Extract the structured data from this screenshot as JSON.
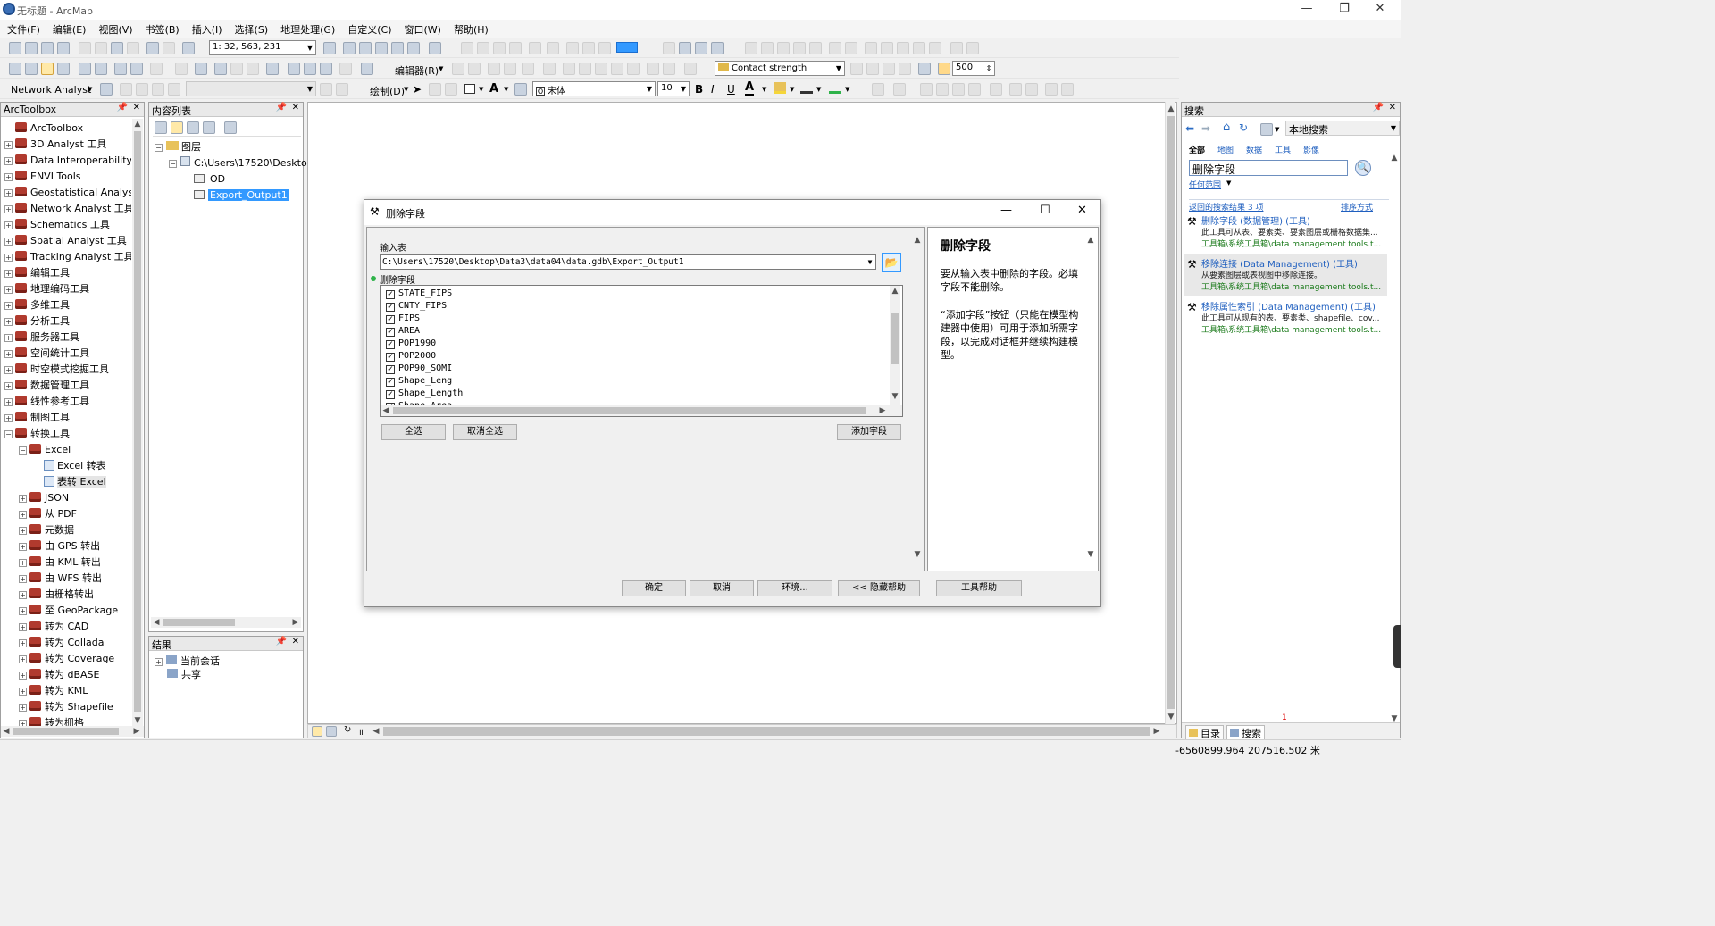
{
  "window": {
    "title": "无标题 - ArcMap"
  },
  "menu": [
    "文件(F)",
    "编辑(E)",
    "视图(V)",
    "书签(B)",
    "插入(I)",
    "选择(S)",
    "地理处理(G)",
    "自定义(C)",
    "窗口(W)",
    "帮助(H)"
  ],
  "toolbar": {
    "scale": "1: 32, 563, 231",
    "editor_label": "编辑器(R)",
    "geocode_combo": "Contact strength",
    "network_analyst": "Network Analyst",
    "draw_label": "绘制(D)",
    "font_name": "宋体",
    "font_size": "10",
    "bold": "B",
    "italic": "I",
    "underline": "U",
    "font_color_letter": "A",
    "width_value": "500"
  },
  "arctoolbox": {
    "header": "ArcToolbox",
    "root": "ArcToolbox",
    "items": [
      "3D Analyst 工具",
      "Data Interoperability 工具",
      "ENVI Tools",
      "Geostatistical Analyst",
      "Network Analyst 工具",
      "Schematics 工具",
      "Spatial Analyst 工具",
      "Tracking Analyst 工具",
      "编辑工具",
      "地理编码工具",
      "多维工具",
      "分析工具",
      "服务器工具",
      "空间统计工具",
      "时空模式挖掘工具",
      "数据管理工具",
      "线性参考工具",
      "制图工具",
      "转换工具"
    ],
    "conversion_children": {
      "excel": "Excel",
      "excel_to_table": "Excel 转表",
      "table_to_excel": "表转 Excel",
      "others": [
        "JSON",
        "从 PDF",
        "元数据",
        "由 GPS 转出",
        "由 KML 转出",
        "由 WFS 转出",
        "由栅格转出",
        "至 GeoPackage",
        "转为 CAD",
        "转为 Collada",
        "转为 Coverage",
        "转为 dBASE",
        "转为 KML",
        "转为 Shapefile",
        "转为栅格"
      ]
    }
  },
  "toc": {
    "header": "内容列表",
    "layers": "图层",
    "path": "C:\\Users\\17520\\Deskto",
    "layer1": "OD",
    "layer2": "Export_Output1"
  },
  "results": {
    "header": "结果",
    "current": "当前会话",
    "shared": "共享"
  },
  "dialog": {
    "title": "删除字段",
    "input_table_label": "输入表",
    "input_table_value": "C:\\Users\\17520\\Desktop\\Data3\\data04\\data.gdb\\Export_Output1",
    "drop_fields_label": "删除字段",
    "fields": [
      "STATE_FIPS",
      "CNTY_FIPS",
      "FIPS",
      "AREA",
      "POP1990",
      "POP2000",
      "POP90_SQMI",
      "Shape_Leng",
      "Shape_Length",
      "Shape_Area"
    ],
    "select_all": "全选",
    "unselect_all": "取消全选",
    "add_field": "添加字段",
    "ok": "确定",
    "cancel": "取消",
    "environments": "环境...",
    "hide_help": "<< 隐藏帮助",
    "tool_help": "工具帮助",
    "help_title": "删除字段",
    "help_p1": "要从输入表中删除的字段。必填字段不能删除。",
    "help_p2": "“添加字段”按钮（只能在模型构建器中使用）可用于添加所需字段，以完成对话框并继续构建模型。"
  },
  "search": {
    "header": "搜索",
    "scope_combo": "本地搜索",
    "tabs": [
      "全部",
      "地图",
      "数据",
      "工具",
      "影像"
    ],
    "query": "删除字段",
    "extent": "任何范围",
    "results_count": "返回的搜索结果 3 项",
    "sort": "排序方式",
    "results": [
      {
        "title": "删除字段 (数据管理) (工具)",
        "desc": "此工具可从表、要素类、要素图层或栅格数据集...",
        "path": "工具箱\\系统工具箱\\data management tools.t..."
      },
      {
        "title": "移除连接 (Data Management) (工具)",
        "desc": "从要素图层或表视图中移除连接。",
        "path": "工具箱\\系统工具箱\\data management tools.t..."
      },
      {
        "title": "移除属性索引 (Data Management) (工具)",
        "desc": "此工具可从现有的表、要素类、shapefile、cov...",
        "path": "工具箱\\系统工具箱\\data management tools.t..."
      }
    ],
    "bottom_tab_catalog": "目录",
    "bottom_tab_search": "搜索",
    "bottom_marker": "1"
  },
  "status": {
    "coords": "-6560899.964  207516.502 米"
  },
  "colors": {
    "accent": "#3399ff",
    "link": "#1f5fbf",
    "path_green": "#1a7a1a",
    "toolbox_red": "#b03a2e"
  }
}
